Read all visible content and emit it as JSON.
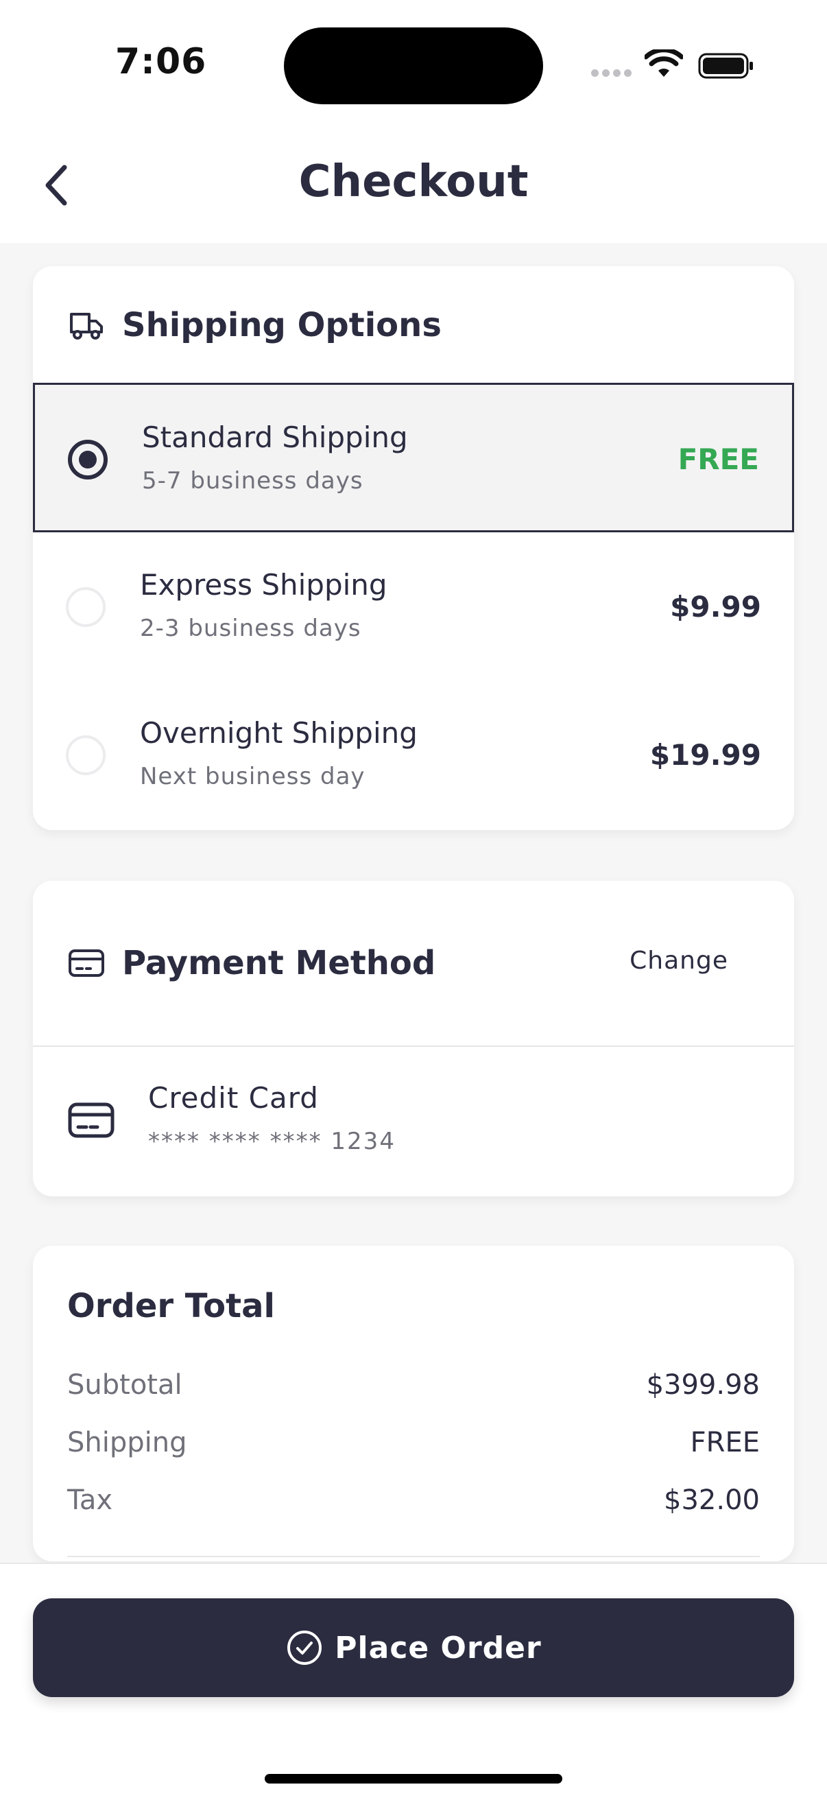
{
  "status": {
    "time": "7:06"
  },
  "header": {
    "title": "Checkout",
    "back_icon": "chevron-left-icon"
  },
  "shipping": {
    "title": "Shipping Options",
    "icon": "truck-icon",
    "options": [
      {
        "name": "Standard Shipping",
        "eta": "5-7 business days",
        "price": "FREE",
        "selected": true
      },
      {
        "name": "Express Shipping",
        "eta": "2-3 business days",
        "price": "$9.99",
        "selected": false
      },
      {
        "name": "Overnight Shipping",
        "eta": "Next business day",
        "price": "$19.99",
        "selected": false
      }
    ]
  },
  "payment": {
    "title": "Payment Method",
    "change_label": "Change",
    "method_name": "Credit Card",
    "card_number": "**** **** **** 1234"
  },
  "total": {
    "title": "Order Total",
    "rows": [
      {
        "label": "Subtotal",
        "value": "$399.98"
      },
      {
        "label": "Shipping",
        "value": "FREE"
      },
      {
        "label": "Tax",
        "value": "$32.00"
      }
    ]
  },
  "actions": {
    "place_order_label": "Place Order"
  },
  "colors": {
    "primary": "#2b2c40",
    "free": "#34a853",
    "muted": "#70707a"
  }
}
